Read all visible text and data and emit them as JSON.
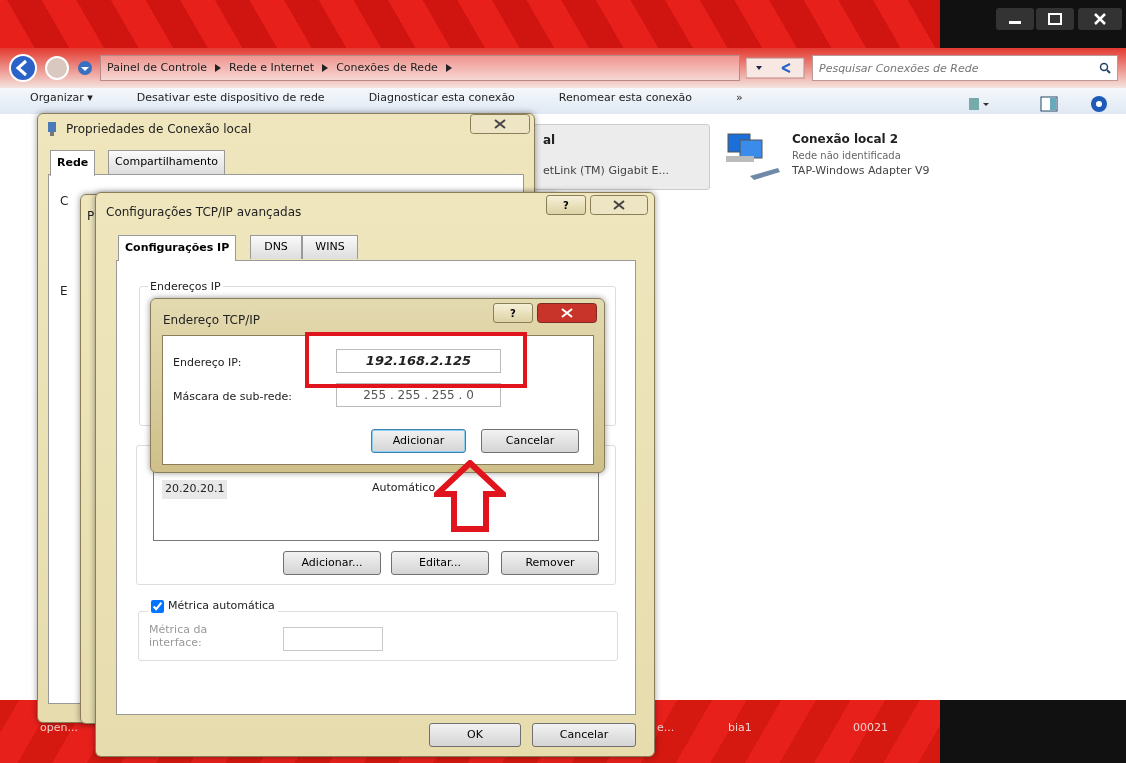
{
  "explorer": {
    "breadcrumb": [
      "Painel de Controle",
      "Rede e Internet",
      "Conexões de Rede"
    ],
    "search": {
      "placeholder": "Pesquisar Conexões de Rede"
    },
    "toolbar": [
      "Organizar ▾",
      "Desativar este dispositivo de rede",
      "Diagnosticar esta conexão",
      "Renomear esta conexão",
      "»"
    ],
    "connections": [
      {
        "name": "al",
        "adapter": "etLink (TM) Gigabit E...",
        "selected": true
      },
      {
        "name": "Conexão local 2",
        "status": "Rede não identificada",
        "adapter": "TAP-Windows Adapter V9",
        "selected": false
      }
    ]
  },
  "properties_dialog": {
    "title": "Propriedades de Conexão local",
    "tabs": [
      {
        "label": "Rede",
        "selected": true
      },
      {
        "label": "Compartilhamento",
        "selected": false
      }
    ],
    "fragments": [
      "C",
      "E"
    ]
  },
  "hidden_dialog": {
    "title": "P"
  },
  "advanced_dialog": {
    "title": "Configurações TCP/IP avançadas",
    "help_button": "?",
    "tabs": [
      {
        "label": "Configurações IP",
        "selected": true
      },
      {
        "label": "DNS",
        "selected": false
      },
      {
        "label": "WINS",
        "selected": false
      }
    ],
    "ip_group": {
      "title": "Endereços IP"
    },
    "gateways": {
      "rows": [
        [
          "20.20.20.1",
          "Automático"
        ]
      ],
      "buttons": [
        "Adicionar...",
        "Editar...",
        "Remover"
      ]
    },
    "metric": {
      "label": "Métrica automática",
      "checked": true,
      "field_label": "Métrica da interface:",
      "disabled": true
    },
    "buttons": [
      "OK",
      "Cancelar"
    ]
  },
  "address_dialog": {
    "title": "Endereço TCP/IP",
    "help_button": "?",
    "fields": [
      {
        "label": "Endereço IP:",
        "value": "192.168.2.125",
        "highlighted": true
      },
      {
        "label": "Máscara de sub-rede:",
        "value": "255 . 255 . 255 . 0",
        "highlighted": false
      }
    ],
    "buttons": [
      {
        "label": "Adicionar",
        "default": true
      },
      {
        "label": "Cancelar",
        "default": false
      }
    ],
    "pointer_arrow": true
  },
  "taskbar": {
    "items": [
      "open...",
      "e...",
      "bia1",
      "00021"
    ]
  }
}
